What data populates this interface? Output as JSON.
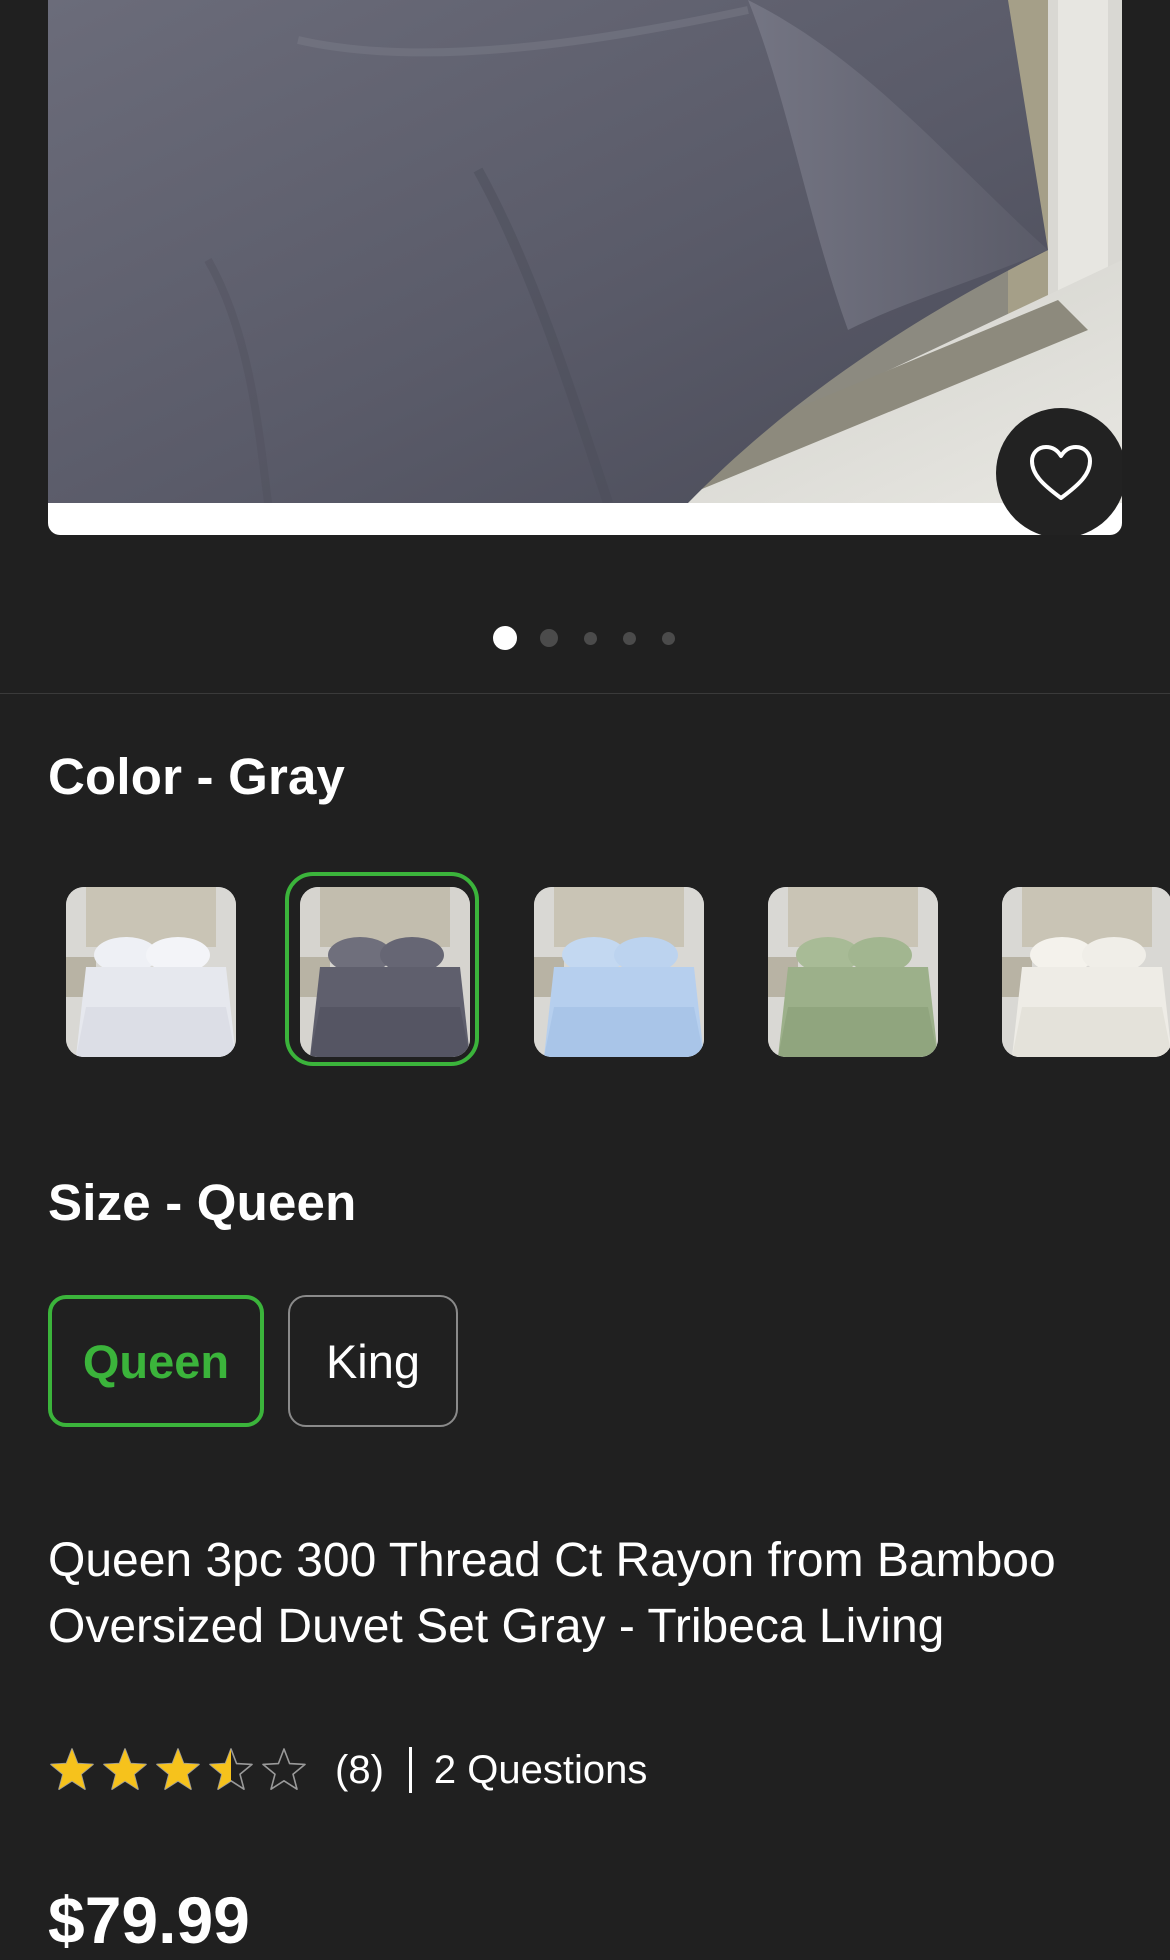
{
  "hero": {
    "favorite_icon": "heart-outline-icon",
    "carousel": {
      "count": 5,
      "active_index": 1
    }
  },
  "color": {
    "heading": "Color - Gray",
    "swatches": [
      {
        "name": "White",
        "hex": "#e6e8ee"
      },
      {
        "name": "Gray",
        "hex": "#5f5f6d"
      },
      {
        "name": "Light Blue",
        "hex": "#b6cfee"
      },
      {
        "name": "Sage",
        "hex": "#9cb08a"
      },
      {
        "name": "Ivory",
        "hex": "#eeece6"
      }
    ],
    "selected_index": 1
  },
  "size": {
    "heading": "Size - Queen",
    "options": [
      "Queen",
      "King"
    ],
    "selected_index": 0
  },
  "product": {
    "title": "Queen 3pc 300 Thread Ct Rayon from Bamboo Oversized Duvet Set Gray - Tribeca Living",
    "rating": 3.5,
    "rating_max": 5,
    "review_count": "(8)",
    "questions": "2 Questions",
    "price": "$79.99"
  },
  "colors": {
    "background": "#202020",
    "accent": "#3bb43b",
    "star": "#f6c21c"
  }
}
